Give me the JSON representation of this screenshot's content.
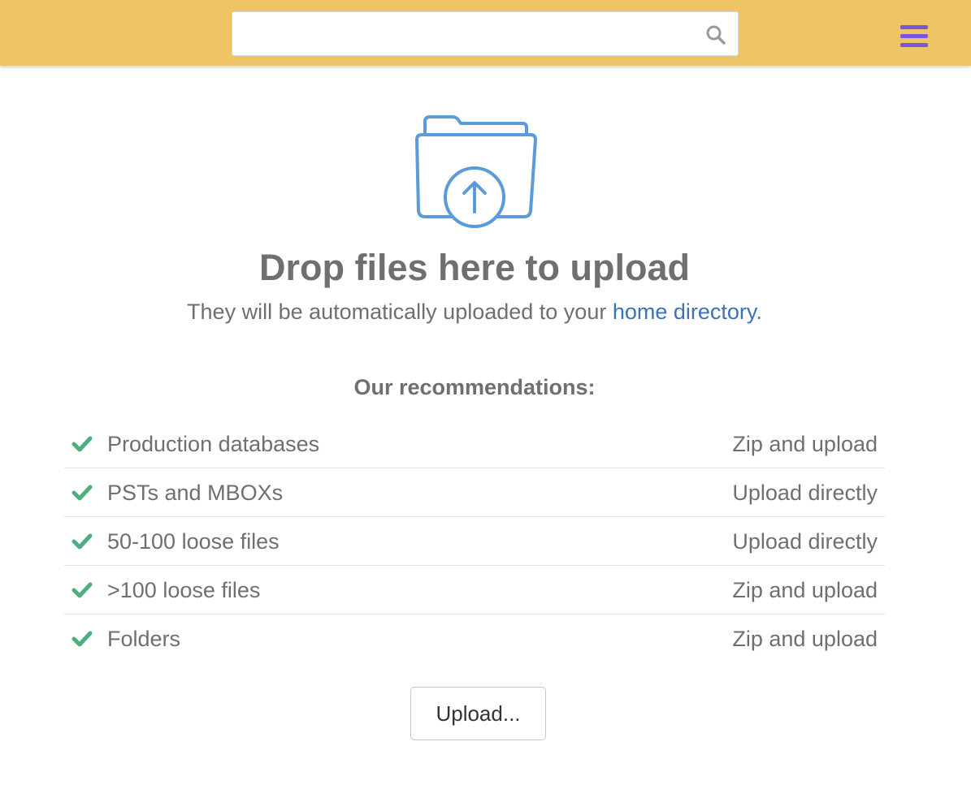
{
  "header": {
    "search": {
      "value": "",
      "placeholder": ""
    },
    "search_icon": "search-icon",
    "menu_icon": "hamburger-menu-icon",
    "background_color": "#eec466",
    "menu_color": "#7a55e0"
  },
  "dropzone": {
    "icon": "folder-upload-icon",
    "icon_color": "#5b9bd9",
    "title": "Drop files here to upload",
    "subtitle_prefix": "They will be automatically uploaded to your ",
    "subtitle_link": "home directory",
    "subtitle_suffix": ".",
    "link_color": "#3e72b4"
  },
  "recommendations": {
    "heading": "Our recommendations:",
    "check_icon": "check-icon",
    "check_color": "#4caf7d",
    "items": [
      {
        "label": "Production databases",
        "action": "Zip and upload"
      },
      {
        "label": "PSTs and MBOXs",
        "action": "Upload directly"
      },
      {
        "label": "50-100 loose files",
        "action": "Upload directly"
      },
      {
        "label": ">100 loose files",
        "action": "Zip and upload"
      },
      {
        "label": "Folders",
        "action": "Zip and upload"
      }
    ]
  },
  "actions": {
    "upload_label": "Upload..."
  }
}
